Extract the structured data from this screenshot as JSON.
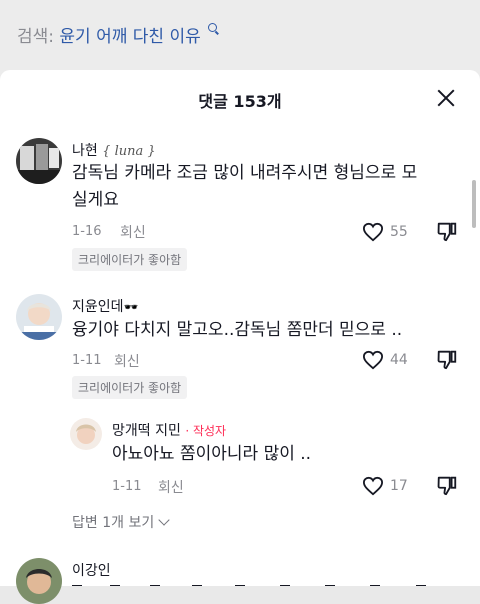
{
  "search": {
    "label": "검색:",
    "query": "윤기 어깨 다친 이유"
  },
  "sheet": {
    "title": "댓글 153개"
  },
  "comments": [
    {
      "username": "나현",
      "username_suffix": "{ luna }",
      "text_line1": "감독님 카메라 조금 많이 내려주시면 형님으로 모",
      "text_line2": "실게요",
      "date": "1-16",
      "reply_label": "회신",
      "likes": "55",
      "creator_liked": "크리에이터가 좋아함"
    },
    {
      "username": "지윤인데",
      "username_emoji": "🕶️",
      "text_line1": "융기야 다치지 말고오..감독님 쫌만더 믿으로 ..",
      "date": "1-11",
      "reply_label": "회신",
      "likes": "44",
      "creator_liked": "크리에이터가 좋아함"
    },
    {
      "username": "이강인",
      "text_line1": ""
    }
  ],
  "reply": {
    "username": "망개떡 지민",
    "author_badge": "· 작성자",
    "text": "아뇨아뇨 쫌이아니라 많이 ..",
    "date": "1-11",
    "reply_label": "회신",
    "likes": "17"
  },
  "view_replies": "답변 1개 보기",
  "colors": {
    "accent": "#fe2c55",
    "query": "#2f5aa8",
    "muted": "#8a8b91"
  }
}
